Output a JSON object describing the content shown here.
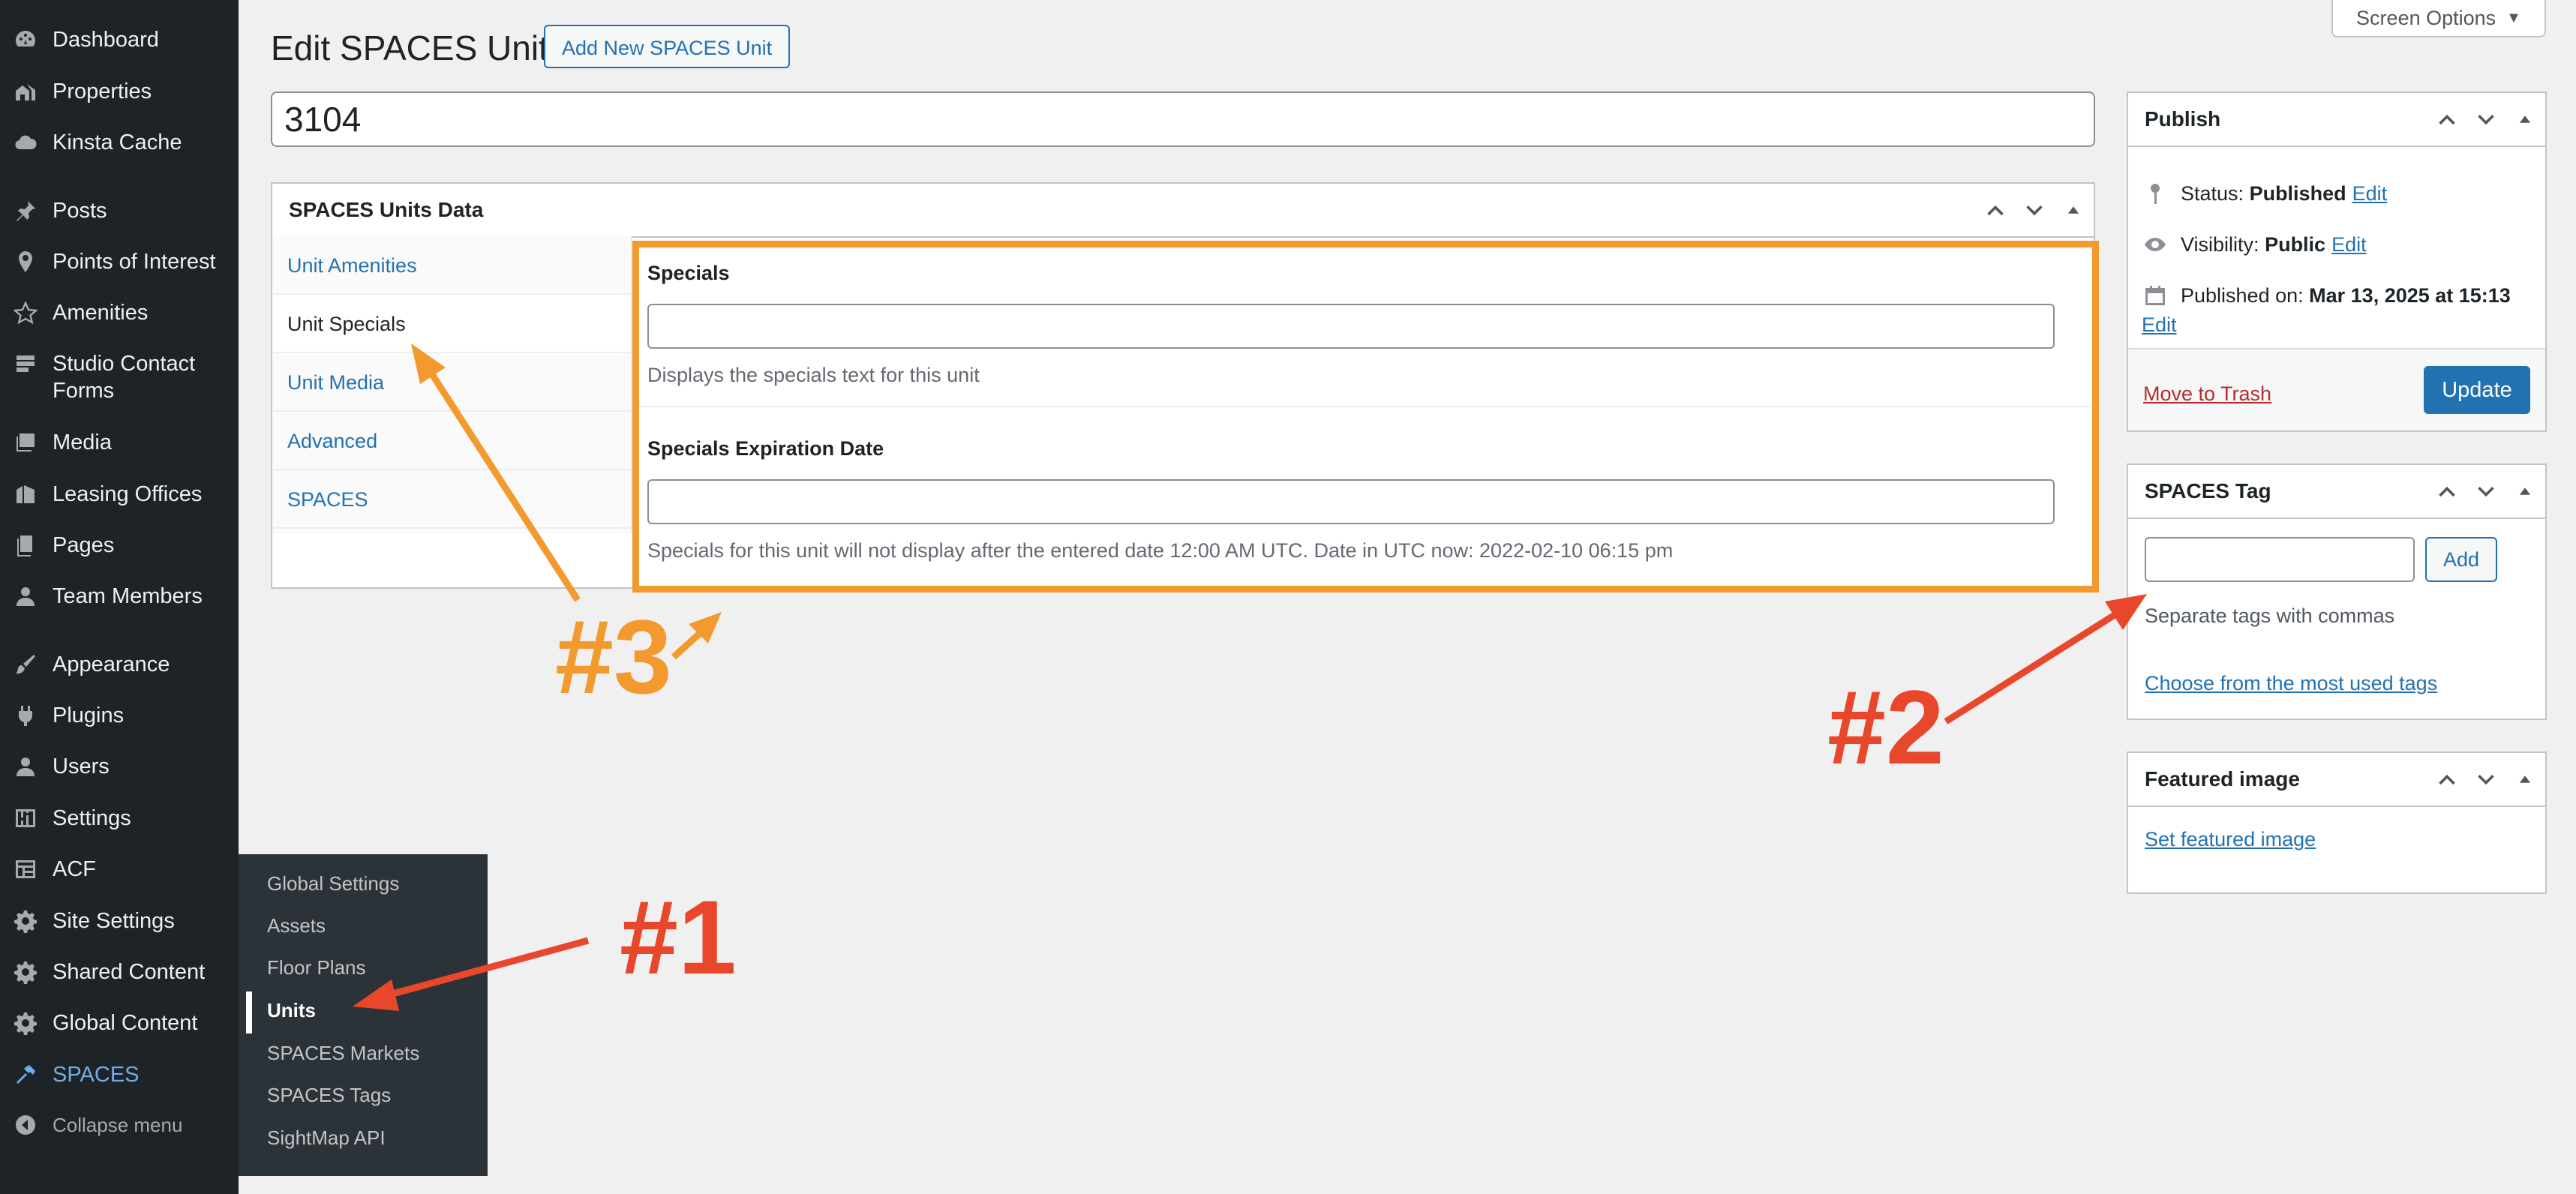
{
  "sidebar": {
    "items": [
      {
        "label": "Dashboard",
        "icon": "dashboard-icon"
      },
      {
        "label": "Properties",
        "icon": "properties-icon"
      },
      {
        "label": "Kinsta Cache",
        "icon": "cloud-icon"
      },
      {
        "label": "Posts",
        "icon": "pin-icon"
      },
      {
        "label": "Points of Interest",
        "icon": "location-icon"
      },
      {
        "label": "Amenities",
        "icon": "star-icon"
      },
      {
        "label": "Studio Contact Forms",
        "icon": "forms-icon"
      },
      {
        "label": "Media",
        "icon": "media-icon"
      },
      {
        "label": "Leasing Offices",
        "icon": "building-icon"
      },
      {
        "label": "Pages",
        "icon": "pages-icon"
      },
      {
        "label": "Team Members",
        "icon": "user-icon"
      },
      {
        "label": "Appearance",
        "icon": "brush-icon"
      },
      {
        "label": "Plugins",
        "icon": "plugin-icon"
      },
      {
        "label": "Users",
        "icon": "users-icon"
      },
      {
        "label": "Settings",
        "icon": "settings-icon"
      },
      {
        "label": "ACF",
        "icon": "acf-icon"
      },
      {
        "label": "Site Settings",
        "icon": "gear-icon"
      },
      {
        "label": "Shared Content",
        "icon": "gear-icon"
      },
      {
        "label": "Global Content",
        "icon": "gear-icon"
      },
      {
        "label": "SPACES",
        "icon": "hammer-icon"
      }
    ],
    "collapse_label": "Collapse menu",
    "collapse_icon": "collapse-icon",
    "submenu": [
      "Global Settings",
      "Assets",
      "Floor Plans",
      "Units",
      "SPACES Markets",
      "SPACES Tags",
      "SightMap API"
    ],
    "submenu_current": "Units"
  },
  "header": {
    "title": "Edit SPACES Unit",
    "add_new_label": "Add New SPACES Unit",
    "screen_options_label": "Screen Options",
    "screen_options_icon": "caret-down-icon"
  },
  "post_title": "3104",
  "units_data": {
    "title": "SPACES Units Data",
    "tabs": [
      "Unit Amenities",
      "Unit Specials",
      "Unit Media",
      "Advanced",
      "SPACES"
    ],
    "active_tab": "Unit Specials",
    "fields": [
      {
        "label": "Specials",
        "value": "",
        "description": "Displays the specials text for this unit"
      },
      {
        "label": "Specials Expiration Date",
        "value": "",
        "description": "Specials for this unit will not display after the entered date 12:00 AM UTC. Date in UTC now: 2022-02-10 06:15 pm"
      }
    ]
  },
  "publish": {
    "title": "Publish",
    "status_label": "Status:",
    "status_value": "Published",
    "visibility_label": "Visibility:",
    "visibility_value": "Public",
    "published_label": "Published on:",
    "published_value": "Mar 13, 2025 at 15:13",
    "edit_label": "Edit",
    "trash_label": "Move to Trash",
    "update_label": "Update"
  },
  "tags": {
    "title": "SPACES Tag",
    "input_value": "",
    "add_label": "Add",
    "help": "Separate tags with commas",
    "most_used_link": "Choose from the most used tags"
  },
  "featured": {
    "title": "Featured image",
    "set_link": "Set featured image"
  },
  "annotations": {
    "a1": "#1",
    "a2": "#2",
    "a3": "#3",
    "color_red": "#e8472b",
    "color_orange": "#f29a2e"
  }
}
